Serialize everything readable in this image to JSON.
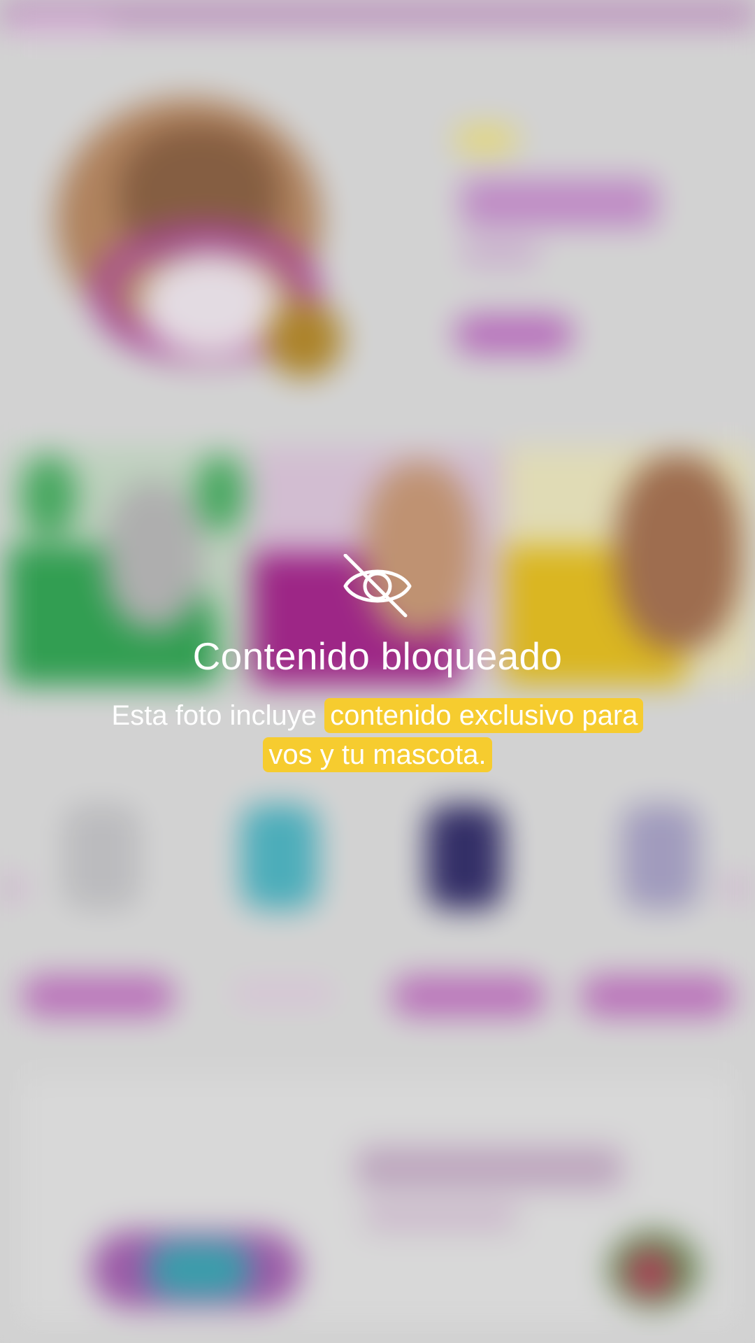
{
  "overlay": {
    "icon": "eye-off-icon",
    "title": "Contenido bloqueado",
    "description_plain": "Esta foto incluye ",
    "description_highlight": "contenido exclusivo para vos y tu mascota.",
    "highlight_color": "#f6cc2f",
    "text_color": "#ffffff"
  }
}
